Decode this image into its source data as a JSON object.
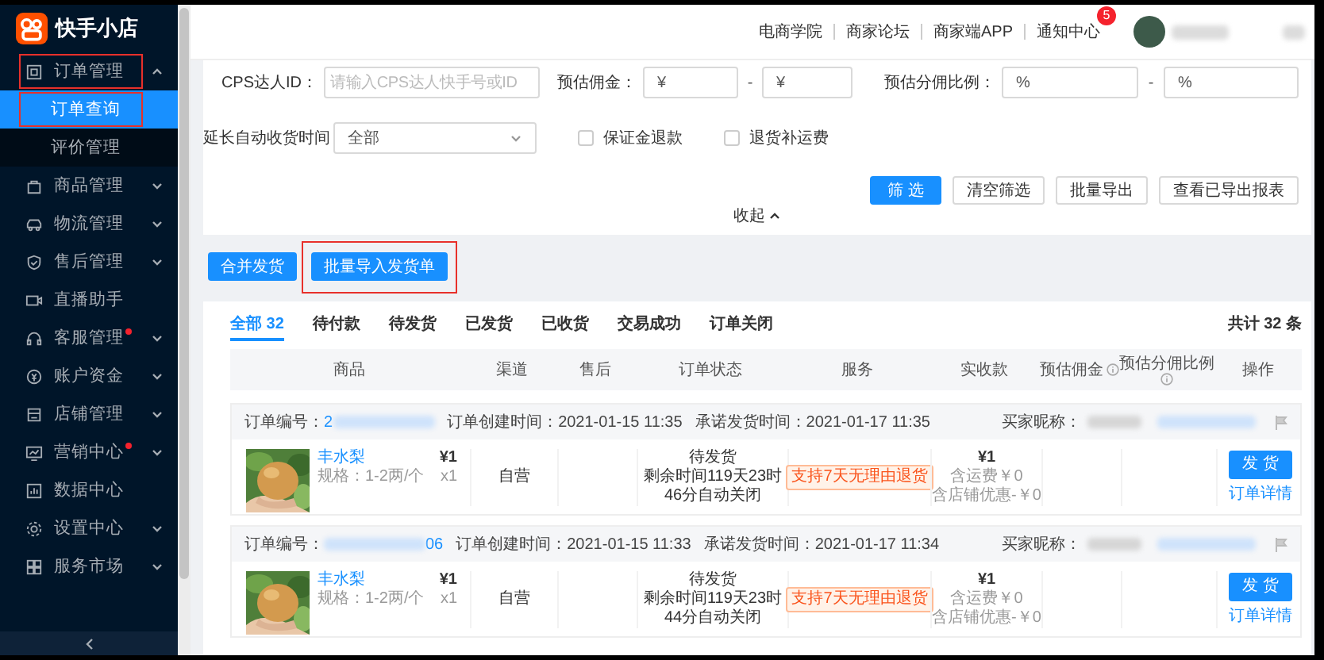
{
  "brand": {
    "name": "快手小店"
  },
  "sidebar": {
    "items": [
      {
        "label": "订单管理",
        "kind": "group",
        "expanded": true,
        "dot": false,
        "annotated": true,
        "children": [
          {
            "label": "订单查询",
            "selected": true,
            "annotated": true
          },
          {
            "label": "评价管理",
            "selected": false,
            "annotated": false
          }
        ]
      },
      {
        "label": "商品管理",
        "kind": "group",
        "expanded": false,
        "dot": false,
        "annotated": false
      },
      {
        "label": "物流管理",
        "kind": "group",
        "expanded": false,
        "dot": false,
        "annotated": false
      },
      {
        "label": "售后管理",
        "kind": "group",
        "expanded": false,
        "dot": false,
        "annotated": false
      },
      {
        "label": "直播助手",
        "kind": "link",
        "dot": false,
        "annotated": false
      },
      {
        "label": "客服管理",
        "kind": "group",
        "expanded": false,
        "dot": true,
        "annotated": false
      },
      {
        "label": "账户资金",
        "kind": "group",
        "expanded": false,
        "dot": false,
        "annotated": false
      },
      {
        "label": "店铺管理",
        "kind": "group",
        "expanded": false,
        "dot": false,
        "annotated": false
      },
      {
        "label": "营销中心",
        "kind": "group",
        "expanded": false,
        "dot": true,
        "annotated": false
      },
      {
        "label": "数据中心",
        "kind": "link",
        "dot": false,
        "annotated": false
      },
      {
        "label": "设置中心",
        "kind": "group",
        "expanded": false,
        "dot": false,
        "annotated": false
      },
      {
        "label": "服务市场",
        "kind": "group",
        "expanded": false,
        "dot": false,
        "annotated": false
      }
    ]
  },
  "top_bar": {
    "links": [
      "电商学院",
      "商家论坛",
      "商家端APP",
      "通知中心"
    ],
    "notification_count": "5"
  },
  "filters": {
    "row_1": [
      {
        "label": "CPS达人ID：",
        "inputs": [
          {
            "placeholder": "请输入CPS达人快手号或ID"
          }
        ]
      },
      {
        "label": "预估佣金：",
        "inputs": [
          {
            "prefix": "¥"
          },
          {
            "prefix": "¥"
          }
        ],
        "separator": "-"
      },
      {
        "label": "预估分佣比例：",
        "inputs": [
          {
            "prefix": "%"
          },
          {
            "prefix": "%"
          }
        ],
        "separator": "-"
      }
    ],
    "delay_receipt": {
      "label": "延长自动收货时间",
      "value": "全部"
    },
    "checkboxes": [
      {
        "label": "保证金退款",
        "checked": false
      },
      {
        "label": "退货补运费",
        "checked": false
      }
    ],
    "buttons": [
      {
        "label": "筛 选",
        "kind": "primary"
      },
      {
        "label": "清空筛选",
        "kind": "default"
      },
      {
        "label": "批量导出",
        "kind": "default"
      },
      {
        "label": "查看已导出报表",
        "kind": "default"
      }
    ],
    "collapse": "收起"
  },
  "actions": [
    {
      "label": "合并发货",
      "annotated": false
    },
    {
      "label": "批量导入发货单",
      "annotated": true
    }
  ],
  "tabs": [
    {
      "label": "全部 32",
      "selected": true
    },
    {
      "label": "待付款",
      "selected": false
    },
    {
      "label": "待发货",
      "selected": false
    },
    {
      "label": "已发货",
      "selected": false
    },
    {
      "label": "已收货",
      "selected": false
    },
    {
      "label": "交易成功",
      "selected": false
    },
    {
      "label": "订单关闭",
      "selected": false
    }
  ],
  "total": "共计 32 条",
  "table": {
    "columns": [
      {
        "label": "商品",
        "info": false
      },
      {
        "label": "渠道",
        "info": false
      },
      {
        "label": "售后",
        "info": false
      },
      {
        "label": "订单状态",
        "info": false
      },
      {
        "label": "服务",
        "info": false
      },
      {
        "label": "实收款",
        "info": false
      },
      {
        "label": "预估佣金",
        "info": true
      },
      {
        "label": "预估分佣比例",
        "info": true
      },
      {
        "label": "操作",
        "info": false
      }
    ]
  },
  "orders": [
    {
      "number_label": "订单编号：",
      "number_prefix": "2",
      "created_label": "订单创建时间：",
      "created": "2021-01-15 11:35",
      "promise_label": "承诺发货时间：",
      "promise": "2021-01-17 11:35",
      "buyer_label": "买家昵称：",
      "product": {
        "name": "丰水梨",
        "spec": "规格：1-2两/个",
        "price": "¥1",
        "qty": "x1"
      },
      "channel": "自营",
      "status": "待发货",
      "countdown": [
        "剩余时间119天23时",
        "46分自动关闭"
      ],
      "service_tag": "支持7天无理由退货",
      "paid": "¥1",
      "shipping": "含运费￥0",
      "discount": "含店铺优惠-￥0",
      "ship_button": "发 货",
      "detail_link": "订单详情"
    },
    {
      "number_label": "订单编号：",
      "number_suffix": "06",
      "created_label": "订单创建时间：",
      "created": "2021-01-15 11:33",
      "promise_label": "承诺发货时间：",
      "promise": "2021-01-17 11:34",
      "buyer_label": "买家昵称：",
      "product": {
        "name": "丰水梨",
        "spec": "规格：1-2两/个",
        "price": "¥1",
        "qty": "x1"
      },
      "channel": "自营",
      "status": "待发货",
      "countdown": [
        "剩余时间119天23时",
        "44分自动关闭"
      ],
      "service_tag": "支持7天无理由退货",
      "paid": "¥1",
      "shipping": "含运费￥0",
      "discount": "含店铺优惠-￥0",
      "ship_button": "发 货",
      "detail_link": "订单详情"
    }
  ]
}
